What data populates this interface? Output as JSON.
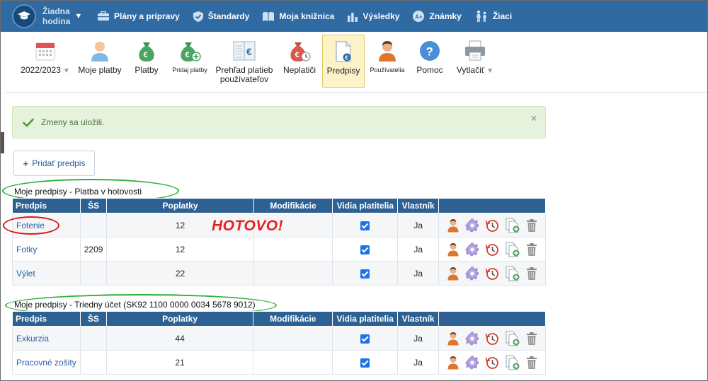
{
  "nav": {
    "brand_line1": "Žiadna",
    "brand_line2": "hodina",
    "items": [
      {
        "label": "Plány a prípravy",
        "icon": "briefcase-icon"
      },
      {
        "label": "Štandardy",
        "icon": "shield-icon"
      },
      {
        "label": "Moja knižnica",
        "icon": "book-icon"
      },
      {
        "label": "Výsledky",
        "icon": "bar-chart-icon"
      },
      {
        "label": "Známky",
        "icon": "grade-icon"
      },
      {
        "label": "Žiaci",
        "icon": "students-icon"
      }
    ],
    "color": "#2f6aa3"
  },
  "toolbar": {
    "year": "2022/2023",
    "my_payments": "Moje platby",
    "payments": "Platby",
    "add_payment": "Pridaj platby",
    "overview_line1": "Prehľad platieb",
    "overview_line2": "používateľov",
    "nonpayers": "Neplatiči",
    "regulations": "Predpisy",
    "users": "Používatelia",
    "help": "Pomoc",
    "print": "Vytlačiť"
  },
  "alert": {
    "message": "Zmeny sa uložili.",
    "close": "×"
  },
  "add_button": "Pridať predpis",
  "columns": {
    "predpis": "Predpis",
    "ss": "ŠS",
    "poplatky": "Poplatky",
    "modifikacie": "Modifikácie",
    "vidia": "Vidia platitelia",
    "vlastnik": "Vlastník"
  },
  "sections": [
    {
      "title": "Moje predpisy - Platba v hotovosti",
      "rows": [
        {
          "name": "Fotenie",
          "ss": "",
          "fees": "12",
          "mods": "",
          "visible": true,
          "owner": "Ja"
        },
        {
          "name": "Fotky",
          "ss": "2209",
          "fees": "12",
          "mods": "",
          "visible": true,
          "owner": "Ja"
        },
        {
          "name": "Výlet",
          "ss": "",
          "fees": "22",
          "mods": "",
          "visible": true,
          "owner": "Ja"
        }
      ]
    },
    {
      "title": "Moje predpisy - Triedny účet (SK92 1100 0000 0034 5678 9012)",
      "rows": [
        {
          "name": "Exkurzia",
          "ss": "",
          "fees": "44",
          "mods": "",
          "visible": true,
          "owner": "Ja"
        },
        {
          "name": "Pracovné zošity",
          "ss": "",
          "fees": "21",
          "mods": "",
          "visible": true,
          "owner": "Ja"
        }
      ]
    }
  ],
  "annotation": "HOTOVO!",
  "colors": {
    "header": "#2e6193",
    "link": "#2a62a5",
    "annotation_red": "#e82020",
    "annotation_green": "#2fae3a"
  }
}
